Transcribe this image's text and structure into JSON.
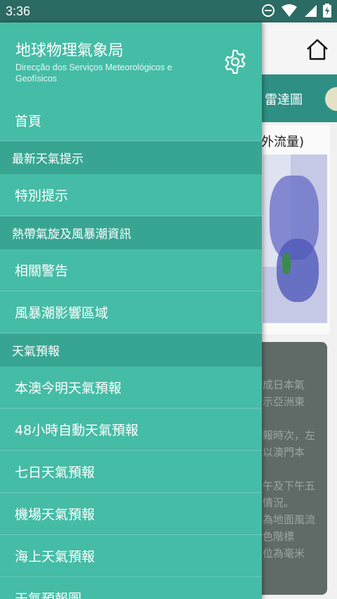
{
  "status_bar": {
    "time": "3:36",
    "icons": [
      "do-not-disturb-icon",
      "wifi-icon",
      "cellular-signal-icon",
      "battery-charging-icon"
    ]
  },
  "drawer": {
    "title": "地球物理氣象局",
    "subtitle": "Direcção dos Serviços Meteorológicos e Geofísicos",
    "items": [
      {
        "type": "item",
        "label": "首頁"
      },
      {
        "type": "section",
        "label": "最新天氣提示"
      },
      {
        "type": "item",
        "label": "特別提示"
      },
      {
        "type": "section",
        "label": "熱帶氣旋及風暴潮資訊"
      },
      {
        "type": "item",
        "label": "相關警告"
      },
      {
        "type": "item",
        "label": "風暴潮影響區域"
      },
      {
        "type": "section",
        "label": "天氣預報"
      },
      {
        "type": "item",
        "label": "本澳今明天氣預報"
      },
      {
        "type": "item",
        "label": "48小時自動天氣預報"
      },
      {
        "type": "item",
        "label": "七日天氣預報"
      },
      {
        "type": "item",
        "label": "機場天氣預報"
      },
      {
        "type": "item",
        "label": "海上天氣預報"
      },
      {
        "type": "item",
        "label": "天氣預報圖"
      }
    ]
  },
  "background": {
    "tab_label": "雷達圖",
    "map_title": "外流量)",
    "text_lines": [
      "成日本氣",
      "示亞洲東",
      "報時次，左",
      "以澳門本",
      "午及下午五",
      "情況。",
      "為地面風流",
      "色階標",
      "位為毫米"
    ]
  },
  "colors": {
    "drawer": "#45bca6",
    "section": "#38a592",
    "status_bar": "#2c6b63",
    "tab_bar": "#2e8f84"
  }
}
